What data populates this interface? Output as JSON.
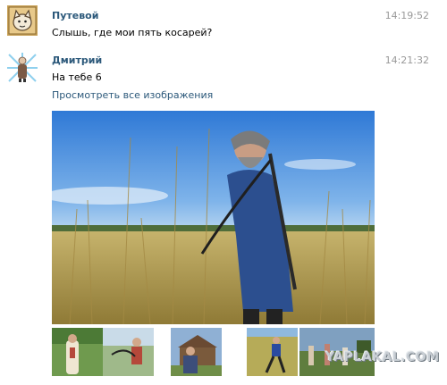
{
  "messages": [
    {
      "author": "Путевой",
      "time": "14:19:52",
      "text": "Слышь, где мои пять косарей?"
    },
    {
      "author": "Дмитрий",
      "time": "14:21:32",
      "text": "На тебе 6",
      "link": "Просмотреть все изображения"
    }
  ],
  "watermark": "YAPLAKAL.COM",
  "colors": {
    "author": "#2b587a",
    "time": "#999999",
    "sky": "#5f9be0",
    "field": "#b39b4e"
  }
}
